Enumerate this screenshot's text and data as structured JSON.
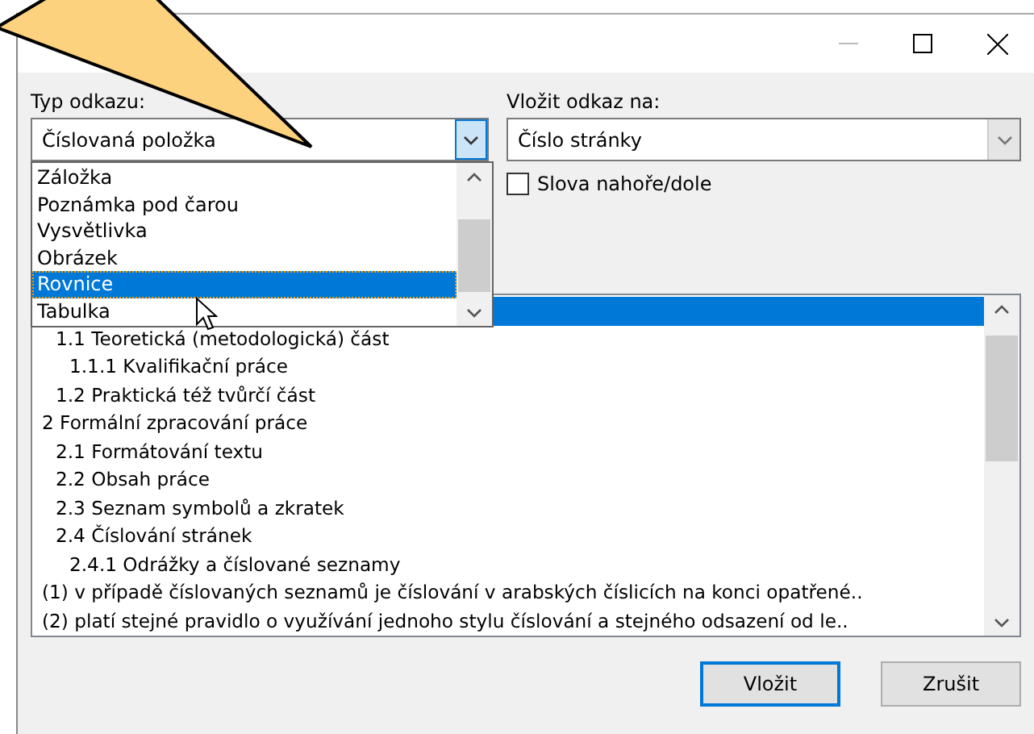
{
  "reference_type": {
    "label": "Typ odkazu:",
    "value": "Číslovaná položka",
    "open": true,
    "options": [
      {
        "label": "Záložka",
        "selected": false
      },
      {
        "label": "Poznámka pod čarou",
        "selected": false
      },
      {
        "label": "Vysvětlivka",
        "selected": false
      },
      {
        "label": "Obrázek",
        "selected": false
      },
      {
        "label": "Rovnice",
        "selected": true
      },
      {
        "label": "Tabulka",
        "selected": false
      }
    ]
  },
  "insert_reference_to": {
    "label": "Vložit odkaz na:",
    "value": "Číslo stránky"
  },
  "above_below": {
    "label": "Slova nahoře/dole",
    "checked": false
  },
  "items": [
    {
      "selected": true,
      "children": [
        {
          "text": "1.1 Teoretická (metodologická) část",
          "selected": false,
          "children": [
            {
              "text": "1.1.1 Kvalifikační práce",
              "selected": false
            }
          ]
        },
        {
          "text": "1.2 Praktická též tvůrčí část",
          "selected": false
        }
      ]
    },
    {
      "text": "2 Formální zpracování práce",
      "selected": false,
      "children": [
        {
          "text": "2.1 Formátování textu",
          "selected": false
        },
        {
          "text": "2.2 Obsah práce",
          "selected": false
        },
        {
          "text": "2.3 Seznam symbolů a zkratek",
          "selected": false
        },
        {
          "text": "2.4 Číslování stránek",
          "selected": false,
          "children": [
            {
              "text": "2.4.1 Odrážky a číslované seznamy",
              "selected": false
            }
          ]
        }
      ]
    },
    {
      "text": "(1) v případě číslovaných seznamů je číslování v arabských číslicích na konci opatřené..",
      "selected": false
    },
    {
      "text": "(2) platí stejné pravidlo o využívání jednoho stylu číslování a stejného odsazení od le..",
      "selected": false
    }
  ],
  "buttons": [
    {
      "label": "Vložit",
      "default": true
    },
    {
      "label": "Zrušit",
      "default": false
    }
  ]
}
